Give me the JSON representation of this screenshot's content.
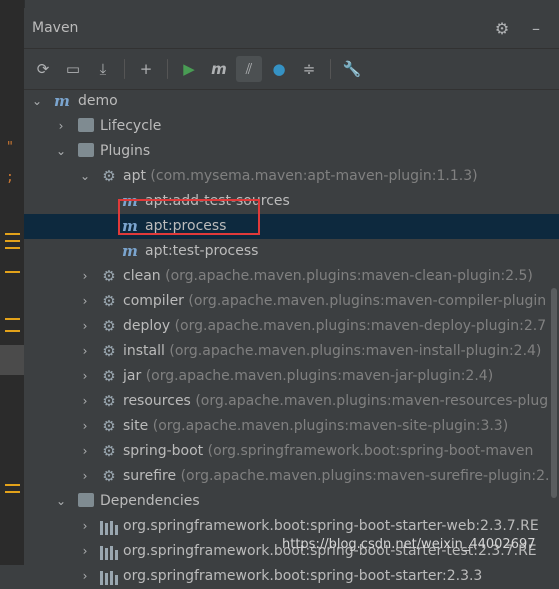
{
  "panel": {
    "title": "Maven"
  },
  "header_icons": [
    "gear-icon",
    "minimize-icon"
  ],
  "toolbar": {
    "buttons": [
      "reload-icon",
      "reimport-folder-icon",
      "download-icon",
      "add-icon",
      "run-icon",
      "maven-goal-icon",
      "toggle-offline-icon",
      "skip-tests-icon",
      "collapse-all-icon",
      "settings-wrench-icon"
    ]
  },
  "tree": {
    "root": "demo",
    "lifecycle": "Lifecycle",
    "plugins": "Plugins",
    "apt": {
      "name": "apt",
      "coord": "(com.mysema.maven:apt-maven-plugin:1.1.3)"
    },
    "goals": [
      "apt:add-test-sources",
      "apt:process",
      "apt:test-process"
    ],
    "plugin_list": [
      {
        "name": "clean",
        "coord": "(org.apache.maven.plugins:maven-clean-plugin:2.5)"
      },
      {
        "name": "compiler",
        "coord": "(org.apache.maven.plugins:maven-compiler-plugin"
      },
      {
        "name": "deploy",
        "coord": "(org.apache.maven.plugins:maven-deploy-plugin:2.7"
      },
      {
        "name": "install",
        "coord": "(org.apache.maven.plugins:maven-install-plugin:2.4)"
      },
      {
        "name": "jar",
        "coord": "(org.apache.maven.plugins:maven-jar-plugin:2.4)"
      },
      {
        "name": "resources",
        "coord": "(org.apache.maven.plugins:maven-resources-plug"
      },
      {
        "name": "site",
        "coord": "(org.apache.maven.plugins:maven-site-plugin:3.3)"
      },
      {
        "name": "spring-boot",
        "coord": "(org.springframework.boot:spring-boot-maven"
      },
      {
        "name": "surefire",
        "coord": "(org.apache.maven.plugins:maven-surefire-plugin:2."
      }
    ],
    "dependencies": "Dependencies",
    "dep_list": [
      "org.springframework.boot:spring-boot-starter-web:2.3.7.RE",
      "org.springframework.boot:spring-boot-starter-test:2.3.7.RE",
      "org.springframework.boot:spring-boot-starter:2.3.3"
    ]
  },
  "watermark": "https://blog.csdn.net/weixin_44002697",
  "colors": {
    "background": "#3c3f41",
    "selection": "#0d293e",
    "highlight_box": "#e03a3a",
    "run_green": "#499c54",
    "blue_icon": "#3592c4"
  }
}
